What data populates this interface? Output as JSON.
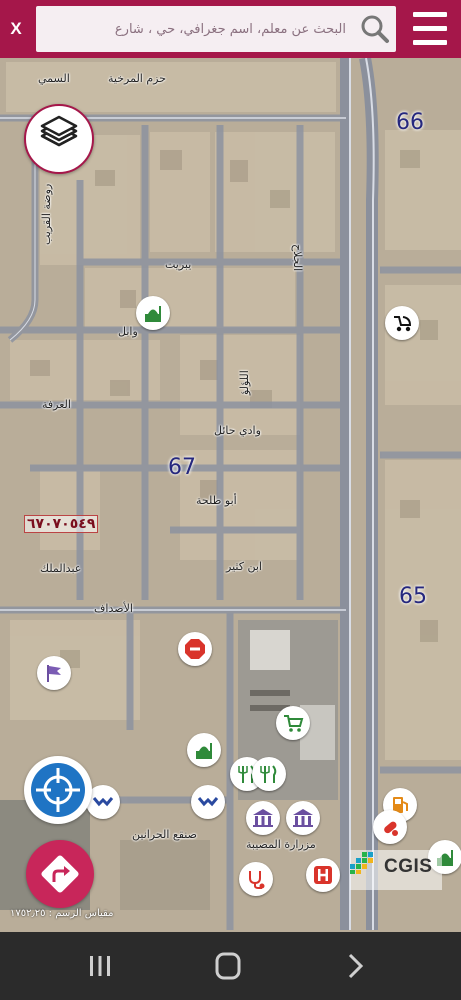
{
  "header": {
    "close_label": "X",
    "search_placeholder": "البحث عن معلم، اسم جغرافي، حي ، شارع",
    "search_value": "",
    "accent_color": "#a5174a"
  },
  "map": {
    "block_labels": [
      "66",
      "67",
      "65"
    ],
    "street_labels": [
      "حزم المرخية",
      "السمي",
      "روضة القريب",
      "يبريت",
      "وابل",
      "اللؤلؤ",
      "العرفة",
      "وادي حائل",
      "أبو طلحة",
      "ابن كثير",
      "عبدالملك",
      "الأصداف",
      "صنقع الحرانين",
      "مزرارة المصيبة",
      "الجلاح"
    ],
    "parcel_label": "٦٧٠٧٠٥٤٩",
    "scale_text": "مقياس الرسم : ١٧٥٢٫٢٥"
  },
  "controls": {
    "layers_icon": "layers-icon",
    "locate_icon": "crosshair-icon",
    "route_icon": "directions-icon"
  },
  "pois": [
    {
      "name": "mosque-icon"
    },
    {
      "name": "stroller-icon"
    },
    {
      "name": "stop-sign-icon"
    },
    {
      "name": "flag-icon"
    },
    {
      "name": "shopping-cart-icon"
    },
    {
      "name": "mosque-icon"
    },
    {
      "name": "restaurant-icon"
    },
    {
      "name": "restaurant-icon"
    },
    {
      "name": "handshake-icon"
    },
    {
      "name": "handshake-icon"
    },
    {
      "name": "museum-icon"
    },
    {
      "name": "museum-icon"
    },
    {
      "name": "fuel-icon"
    },
    {
      "name": "pharmacy-icon"
    },
    {
      "name": "clinic-icon"
    },
    {
      "name": "hospital-icon"
    },
    {
      "name": "mosque-icon"
    }
  ],
  "logo": {
    "text": "CGIS"
  },
  "navigation": {
    "items": [
      "recent-apps-icon",
      "home-icon",
      "back-icon"
    ]
  }
}
